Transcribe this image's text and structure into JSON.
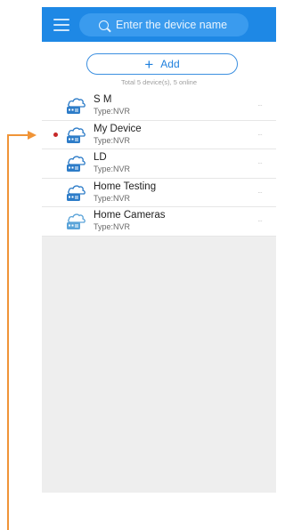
{
  "search": {
    "placeholder": "Enter the device name"
  },
  "add_button": {
    "label": "Add",
    "icon": "plus-icon"
  },
  "summary": "Total 5 device(s), 5 online",
  "devices": [
    {
      "name": "S M",
      "type": "Type:NVR",
      "alert": false,
      "icon_color": "#2d7cc8"
    },
    {
      "name": "My Device",
      "type": "Type:NVR",
      "alert": true,
      "icon_color": "#2d7cc8"
    },
    {
      "name": "LD",
      "type": "Type:NVR",
      "alert": false,
      "icon_color": "#2d7cc8"
    },
    {
      "name": "Home Testing",
      "type": "Type:NVR",
      "alert": false,
      "icon_color": "#2d7cc8"
    },
    {
      "name": "Home Cameras",
      "type": "Type:NVR",
      "alert": false,
      "icon_color": "#5ba4d9"
    }
  ],
  "more_glyph": "···",
  "colors": {
    "header": "#1e88e5",
    "accent": "#1e7fdd",
    "annotation_arrow": "#f09437",
    "alert_dot": "#c62828"
  }
}
